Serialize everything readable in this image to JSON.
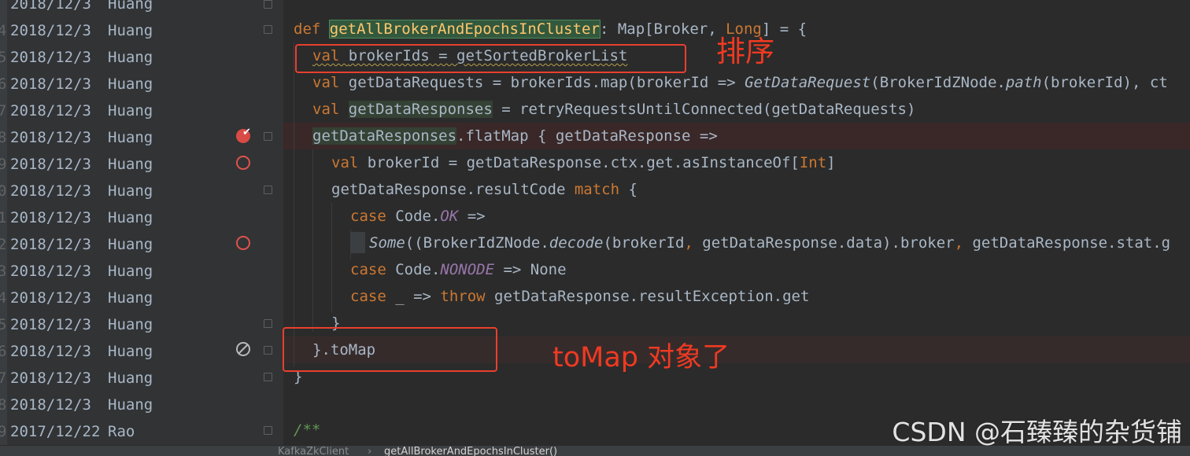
{
  "annotations": [
    {
      "num": "",
      "date": "2018/12/3",
      "author": "Huang"
    },
    {
      "num": "4",
      "date": "2018/12/3",
      "author": "Huang"
    },
    {
      "num": "5",
      "date": "2018/12/3",
      "author": "Huang"
    },
    {
      "num": "6",
      "date": "2018/12/3",
      "author": "Huang"
    },
    {
      "num": "7",
      "date": "2018/12/3",
      "author": "Huang"
    },
    {
      "num": "8",
      "date": "2018/12/3",
      "author": "Huang"
    },
    {
      "num": "9",
      "date": "2018/12/3",
      "author": "Huang"
    },
    {
      "num": "0",
      "date": "2018/12/3",
      "author": "Huang"
    },
    {
      "num": "1",
      "date": "2018/12/3",
      "author": "Huang"
    },
    {
      "num": "2",
      "date": "2018/12/3",
      "author": "Huang"
    },
    {
      "num": "3",
      "date": "2018/12/3",
      "author": "Huang"
    },
    {
      "num": "4",
      "date": "2018/12/3",
      "author": "Huang"
    },
    {
      "num": "5",
      "date": "2018/12/3",
      "author": "Huang"
    },
    {
      "num": "6",
      "date": "2018/12/3",
      "author": "Huang"
    },
    {
      "num": "7",
      "date": "2018/12/3",
      "author": "Huang"
    },
    {
      "num": "8",
      "date": "2018/12/3",
      "author": "Huang"
    },
    {
      "num": "9",
      "date": "2017/12/22",
      "author": "Rao"
    }
  ],
  "code": {
    "l0": {
      "t1": "*/"
    },
    "l1": {
      "t1": "def ",
      "t2": "getAllBrokerAndEpochsInCluster",
      "t3": ": Map[Broker, ",
      "t4": "Long",
      "t5": "] = {"
    },
    "l2": {
      "t1": "val ",
      "t2": "brokerIds = getSortedBrokerList"
    },
    "l3": {
      "t1": "val ",
      "t2": "getDataRequests = brokerIds.map(brokerId => ",
      "t3": "GetDataRequest",
      "t4": "(BrokerIdZNode.",
      "t5": "path",
      "t6": "(brokerId), ct"
    },
    "l4": {
      "t1": "val ",
      "t2": "getDataResponses",
      "t3": " = retryRequestsUntilConnected(getDataRequests)"
    },
    "l5": {
      "t1": "getDataResponses",
      "t2": ".flatMap { getDataResponse =>"
    },
    "l6": {
      "t1": "val ",
      "t2": "brokerId = getDataResponse.ctx.get.asInstanceOf[",
      "t3": "Int",
      "t4": "]"
    },
    "l7": {
      "t1": "getDataResponse.resultCode ",
      "t2": "match",
      "t3": " {"
    },
    "l8": {
      "t1": "case ",
      "t2": "Code.",
      "t3": "OK",
      "t4": " =>"
    },
    "l9": {
      "t1": "Some",
      "t2": "((BrokerIdZNode.",
      "t3": "decode",
      "t4": "(brokerId",
      "t5": ", ",
      "t6": "getDataResponse.data).broker",
      "t7": ", ",
      "t8": "getDataResponse.stat.g"
    },
    "l10": {
      "t1": "case ",
      "t2": "Code.",
      "t3": "NONODE",
      "t4": " => None"
    },
    "l11": {
      "t1": "case ",
      "t2": "_ => ",
      "t3": "throw ",
      "t4": "getDataResponse.resultException.get"
    },
    "l12": {
      "t1": "}"
    },
    "l13": {
      "t1": "}.toMap"
    },
    "l14": {
      "t1": "}"
    },
    "l16": {
      "t1": "/**"
    }
  },
  "callouts": {
    "sort": "排序",
    "tomap": "toMap 对象了"
  },
  "breadcrumb": {
    "class_name": "KafkaZkClient",
    "separator": "›",
    "method_name": "getAllBrokerAndEpochsInCluster()"
  },
  "watermark": "CSDN @石臻臻的杂货铺",
  "colors": {
    "keyword": "#cc7832",
    "function": "#ffc66d",
    "constant": "#9876aa",
    "comment": "#629755",
    "text": "#a9b7c6",
    "breakpoint": "#d94b45",
    "annotation_red": "#e8402e"
  },
  "icons": {
    "breakpoint": "breakpoint-icon",
    "verified_breakpoint": "verified-breakpoint-icon",
    "disabled_breakpoint": "disabled-breakpoint-icon",
    "fold": "fold-icon"
  }
}
